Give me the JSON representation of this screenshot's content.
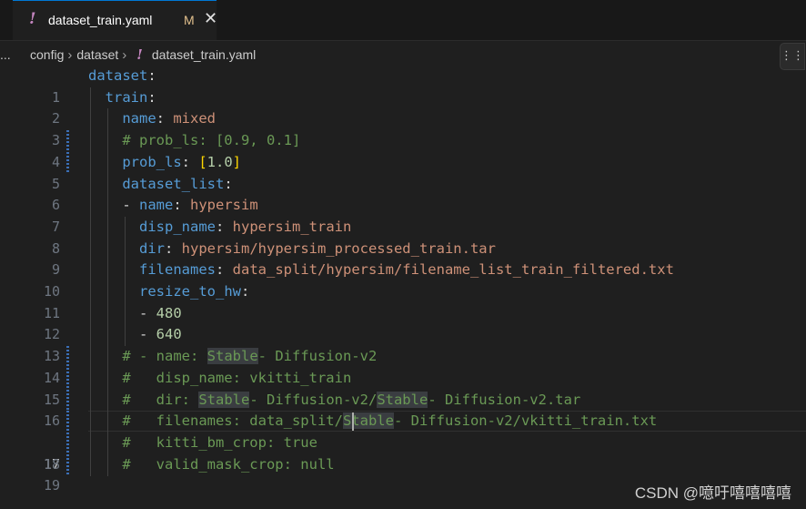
{
  "tab": {
    "icon": "yaml-exclamation-icon",
    "icon_glyph": "!",
    "title": "dataset_train.yaml",
    "modified": "M",
    "close_glyph": "✕"
  },
  "left_dots": "...",
  "breadcrumb": {
    "items": [
      "config",
      "dataset"
    ],
    "separator": "›",
    "file_icon_glyph": "!",
    "file": "dataset_train.yaml"
  },
  "more_button_glyph": "⋮⋮",
  "editor": {
    "active_line": 17,
    "lines": [
      {
        "num": "1"
      },
      {
        "num": "2"
      },
      {
        "num": "3"
      },
      {
        "num": "4"
      },
      {
        "num": "5"
      },
      {
        "num": "6"
      },
      {
        "num": "7"
      },
      {
        "num": "8"
      },
      {
        "num": "9"
      },
      {
        "num": "10"
      },
      {
        "num": "11"
      },
      {
        "num": "12"
      },
      {
        "num": "13"
      },
      {
        "num": "14"
      },
      {
        "num": "15"
      },
      {
        "num": "16"
      },
      {
        "num": "17"
      },
      {
        "num": "18"
      },
      {
        "num": "19"
      }
    ],
    "code": {
      "l1_key": "dataset",
      "l2_key": "train",
      "l3_key": "name",
      "l3_val": "mixed",
      "l4_comment_a": "# prob_ls: [0.9, 0.1]",
      "l5_key": "prob_ls",
      "l5_val": "1.0",
      "l6_key": "dataset_list",
      "l7_key": "name",
      "l7_val": "hypersim",
      "l8_key": "disp_name",
      "l8_val": "hypersim_train",
      "l9_key": "dir",
      "l9_val": "hypersim/hypersim_processed_train.tar",
      "l10_key": "filenames",
      "l10_val": "data_split/hypersim/filename_list_train_filtered.txt",
      "l11_key": "resize_to_hw",
      "l12_val": "480",
      "l13_val": "640",
      "l14_pre": "# - name: ",
      "l14_hl": "Stable",
      "l14_post": "- Diffusion-v2",
      "l15_text": "#   disp_name: vkitti_train",
      "l16_pre": "#   dir: ",
      "l16_hl1": "Stable",
      "l16_mid": "- Diffusion-v2/",
      "l16_hl2": "Stable",
      "l16_post": "- Diffusion-v2.tar",
      "l17_pre": "#   filenames: data_split/",
      "l17_hl": "Stable",
      "l17_post": "- Diffusion-v2/vkitti_train.txt",
      "l18_text": "#   kitti_bm_crop: true",
      "l19_text": "#   valid_mask_crop: null"
    }
  },
  "watermark": "CSDN @噫吁嘻嘻嘻嘻",
  "colors": {
    "background": "#1f1f1f",
    "key": "#569cd6",
    "string": "#ce9178",
    "number": "#b5cea8",
    "comment": "#6a9955",
    "bracket": "#ffd700",
    "modified": "#e2c08d"
  }
}
